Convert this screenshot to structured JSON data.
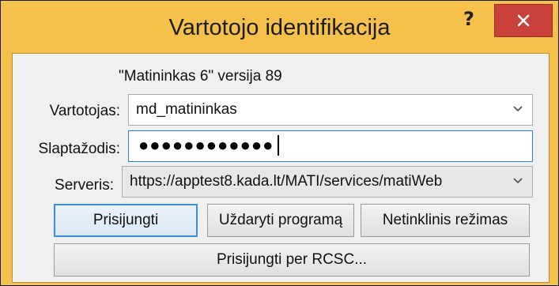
{
  "window": {
    "title": "Vartotojo identifikacija",
    "help_label": "?",
    "close_icon": "close-icon"
  },
  "form": {
    "version_text": "\"Matininkas 6\" versija 89",
    "user_label": "Vartotojas:",
    "user_value": "md_matininkas",
    "password_label": "Slaptažodis:",
    "password_mask": "●●●●●●●●●●●●",
    "server_label": "Serveris:",
    "server_value": "https://apptest8.kada.lt/MATI/services/matiWeb"
  },
  "buttons": {
    "login": "Prisijungti",
    "close_program": "Uždaryti programą",
    "offline": "Netinklinis režimas",
    "login_rcsc": "Prisijungti per RCSC..."
  },
  "colors": {
    "frame": "#f6c14a",
    "close_button": "#c9413a",
    "focus_border": "#2b83d4"
  }
}
